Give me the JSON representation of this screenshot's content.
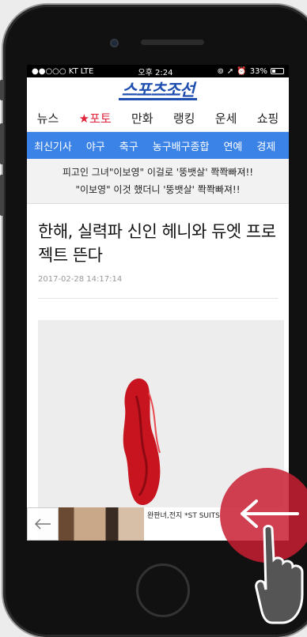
{
  "status_bar": {
    "carrier": "●●○○○ KT",
    "network": "LTE",
    "time": "오후 2:24",
    "icons": [
      "lock-rotation-icon",
      "location-icon",
      "alarm-icon"
    ],
    "battery_text": "33%",
    "battery_level": 0.33
  },
  "header": {
    "logo": "스포츠조선"
  },
  "main_nav": {
    "items": [
      "뉴스",
      "★포토",
      "만화",
      "랭킹",
      "운세",
      "쇼핑"
    ],
    "active_color": "#e0223a"
  },
  "sub_nav": {
    "items": [
      "최신기사",
      "야구",
      "축구",
      "농구배구종합",
      "연예",
      "경제"
    ],
    "background": "#3b83e7"
  },
  "promo": {
    "line1": "피고인 그녀\"이보영\" 이걸로 '뚱뱃살' 쫙쫙빠져!!",
    "line2": "\"이보영\" 이것 했더니 '뚱뱃살' 쫙쫙빠져!!"
  },
  "article": {
    "headline": "한해, 실력파 신인 헤니와 듀엣 프로젝트 뜬다",
    "date": "2017-02-28 14:17:14"
  },
  "ad": {
    "text": "완판녀,전지 *ST SUITS"
  },
  "overlay": {
    "accent": "#c81e32",
    "gesture": "back-arrow-icon"
  }
}
